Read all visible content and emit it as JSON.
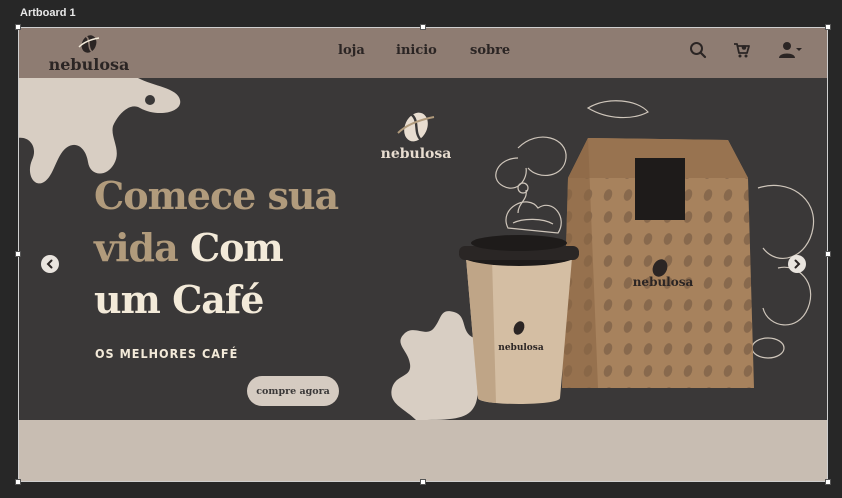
{
  "artboard": {
    "label": "Artboard 1"
  },
  "brand": {
    "name": "nebulosa"
  },
  "nav": {
    "items": [
      "loja",
      "inicio",
      "sobre"
    ]
  },
  "header_icons": [
    "search-icon",
    "cart-icon",
    "user-icon"
  ],
  "hero": {
    "headline_1a": "Comece sua",
    "headline_2a": "vida ",
    "headline_2b": "Com",
    "headline_3a": "um Café",
    "subtitle": "OS MELHORES CAFÉ",
    "cta_label": "compre agora",
    "product_cup_label": "nebulosa",
    "product_bag_label": "nebulosa"
  },
  "colors": {
    "header_bg": "#8e7c72",
    "hero_bg": "#3a3838",
    "accent_tan": "#b19b7c",
    "cream": "#f3ead9",
    "footer_band": "#c8bdb2"
  }
}
